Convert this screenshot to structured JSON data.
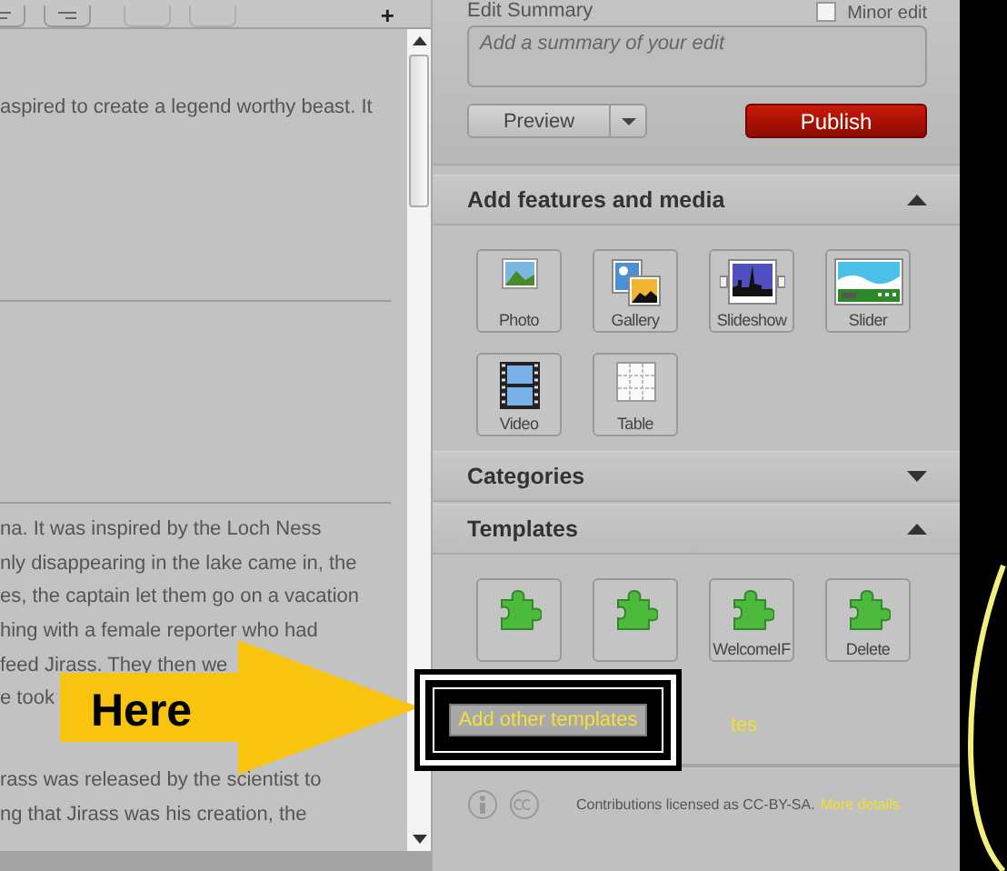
{
  "toolbar": {
    "add_label": "+"
  },
  "editor": {
    "blocks": [
      {
        "kind": "text",
        "lines": [
          "aspired to create a legend worthy beast. It"
        ]
      },
      {
        "kind": "rule"
      },
      {
        "kind": "rule"
      },
      {
        "kind": "text",
        "lines": [
          "na. It was inspired by the Loch Ness",
          "nly disappearing in the lake came in, the",
          "es, the captain let them go on a vacation",
          "hing with a female reporter who had",
          "feed Jirass. They then we",
          "e took"
        ]
      },
      {
        "kind": "text",
        "lines": [
          "rass was released by the scientist to",
          "ng that Jirass was his creation, the"
        ]
      }
    ]
  },
  "summary": {
    "label": "Edit Summary",
    "placeholder": "Add a summary of your edit",
    "minor_edit": {
      "label": "Minor edit",
      "checked": false
    }
  },
  "buttons": {
    "preview": "Preview",
    "publish": "Publish"
  },
  "sections": [
    {
      "title": "Add features and media",
      "expanded": true,
      "items": [
        {
          "label": "Photo",
          "kind": "photo"
        },
        {
          "label": "Gallery",
          "kind": "gallery"
        },
        {
          "label": "Slideshow",
          "kind": "slideshow"
        },
        {
          "label": "Slider",
          "kind": "slider"
        },
        {
          "label": "Video",
          "kind": "video"
        },
        {
          "label": "Table",
          "kind": "table"
        }
      ]
    },
    {
      "title": "Categories",
      "expanded": false
    },
    {
      "title": "Templates",
      "expanded": true,
      "items": [
        {
          "kind": "puzzle"
        },
        {
          "kind": "puzzle"
        },
        {
          "label": "WelcomeIF",
          "kind": "puzzle"
        },
        {
          "label": "Delete",
          "kind": "puzzle"
        }
      ],
      "link": "tes"
    }
  ],
  "footer": {
    "license": "Contributions licensed as CC-BY-SA.",
    "link": "More details."
  },
  "callout": {
    "label": "Here"
  },
  "highlight": {
    "label": "Add other templates"
  }
}
